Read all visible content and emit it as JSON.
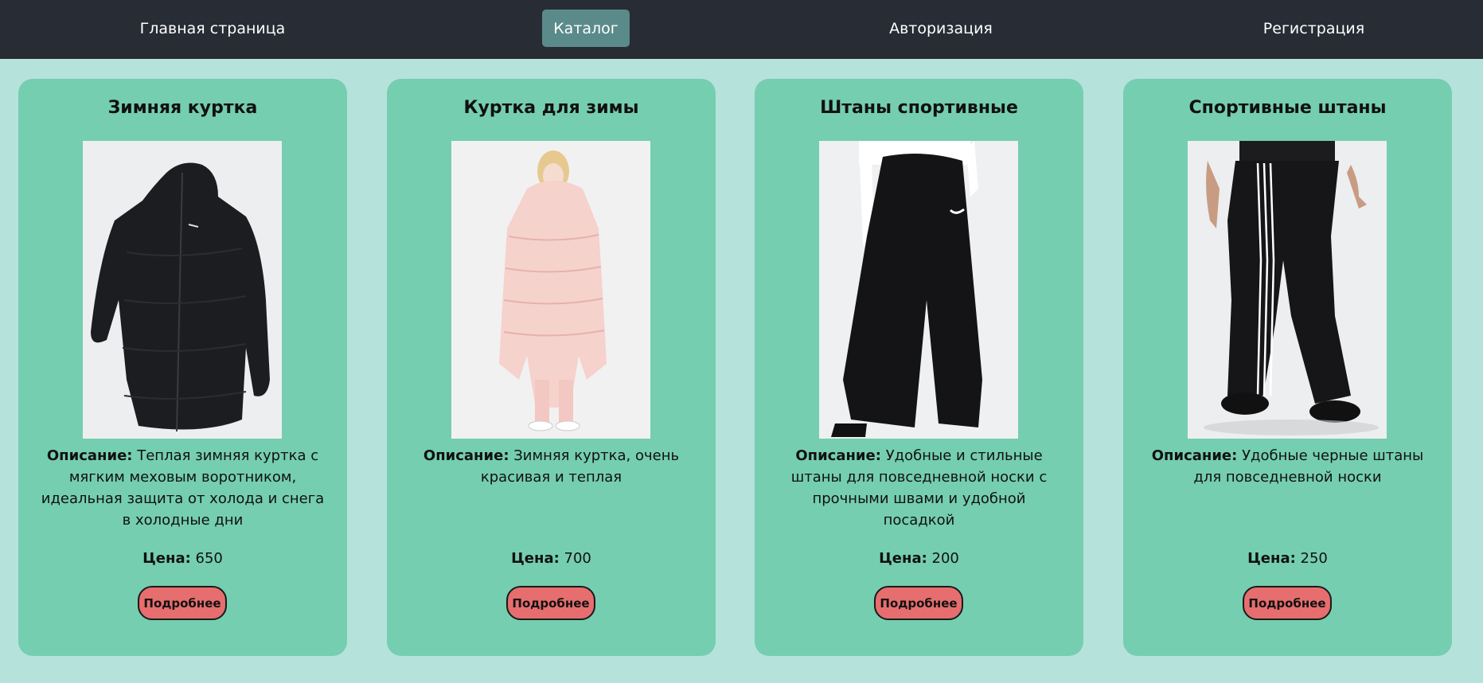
{
  "nav": {
    "home": "Главная страница",
    "catalog": "Каталог",
    "login": "Авторизация",
    "register": "Регистрация"
  },
  "labels": {
    "description": "Описание:",
    "price": "Цена:",
    "details_button": "Подробнее"
  },
  "products": [
    {
      "title": "Зимняя куртка",
      "description": "Теплая зимняя куртка с мягким меховым воротником, идеальная защита от холода и снега в холодные дни",
      "price": "650",
      "image": "black-puffer-jacket-photo"
    },
    {
      "title": "Куртка для зимы",
      "description": "Зимняя куртка, очень красивая и теплая",
      "price": "700",
      "image": "pink-long-puffer-coat-photo"
    },
    {
      "title": "Штаны спортивные",
      "description": "Удобные и стильные штаны для повседневной носки с прочными швами и удобной посадкой",
      "price": "200",
      "image": "black-wide-sweatpants-photo"
    },
    {
      "title": "Спортивные штаны",
      "description": "Удобные черные штаны для повседневной носки",
      "price": "250",
      "image": "black-striped-track-pants-photo"
    }
  ],
  "colors": {
    "navbar": "#272c35",
    "nav_active": "#5b8a8a",
    "page_background": "#b6e2dc",
    "card_background": "#75ceb0",
    "button": "#e66e6e"
  }
}
